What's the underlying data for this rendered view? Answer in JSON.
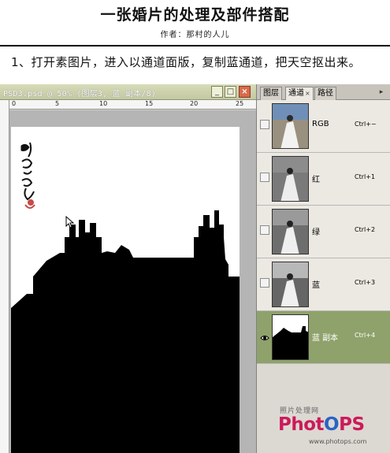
{
  "header": {
    "title": "一张婚片的处理及部件搭配",
    "author": "作者：那村的人儿"
  },
  "step_text": "1、打开素图片，进入以通道面版，复制蓝通道，把天空抠出来。",
  "document": {
    "title": "PSD3.psd @ 50% (图层3, 蓝 副本/8)",
    "minimize": "_",
    "maximize": "□",
    "close": "×",
    "ruler_labels": [
      "0",
      "5",
      "10",
      "15",
      "20",
      "25"
    ]
  },
  "panel": {
    "tabs": [
      {
        "label": "图层",
        "close": ""
      },
      {
        "label": "通道",
        "close": "×"
      },
      {
        "label": "路径",
        "close": ""
      }
    ],
    "menu": "▸",
    "channels": [
      {
        "name": "RGB",
        "shortcut": "Ctrl+~",
        "visible": false,
        "selected": false
      },
      {
        "name": "红",
        "shortcut": "Ctrl+1",
        "visible": false,
        "selected": false
      },
      {
        "name": "绿",
        "shortcut": "Ctrl+2",
        "visible": false,
        "selected": false
      },
      {
        "name": "蓝",
        "shortcut": "Ctrl+3",
        "visible": false,
        "selected": false
      },
      {
        "name": "蓝 副本",
        "shortcut": "Ctrl+4",
        "visible": true,
        "selected": true
      }
    ]
  },
  "watermark": {
    "cn": "照片处理网",
    "logo_a": "Phot",
    "logo_b": "O",
    "logo_c": "PS",
    "url": "www.photops.com"
  },
  "colors": {
    "selected_channel": "#8fa26b",
    "panel_bg": "#d4d0c8",
    "canvas_bg": "#ffffff"
  }
}
